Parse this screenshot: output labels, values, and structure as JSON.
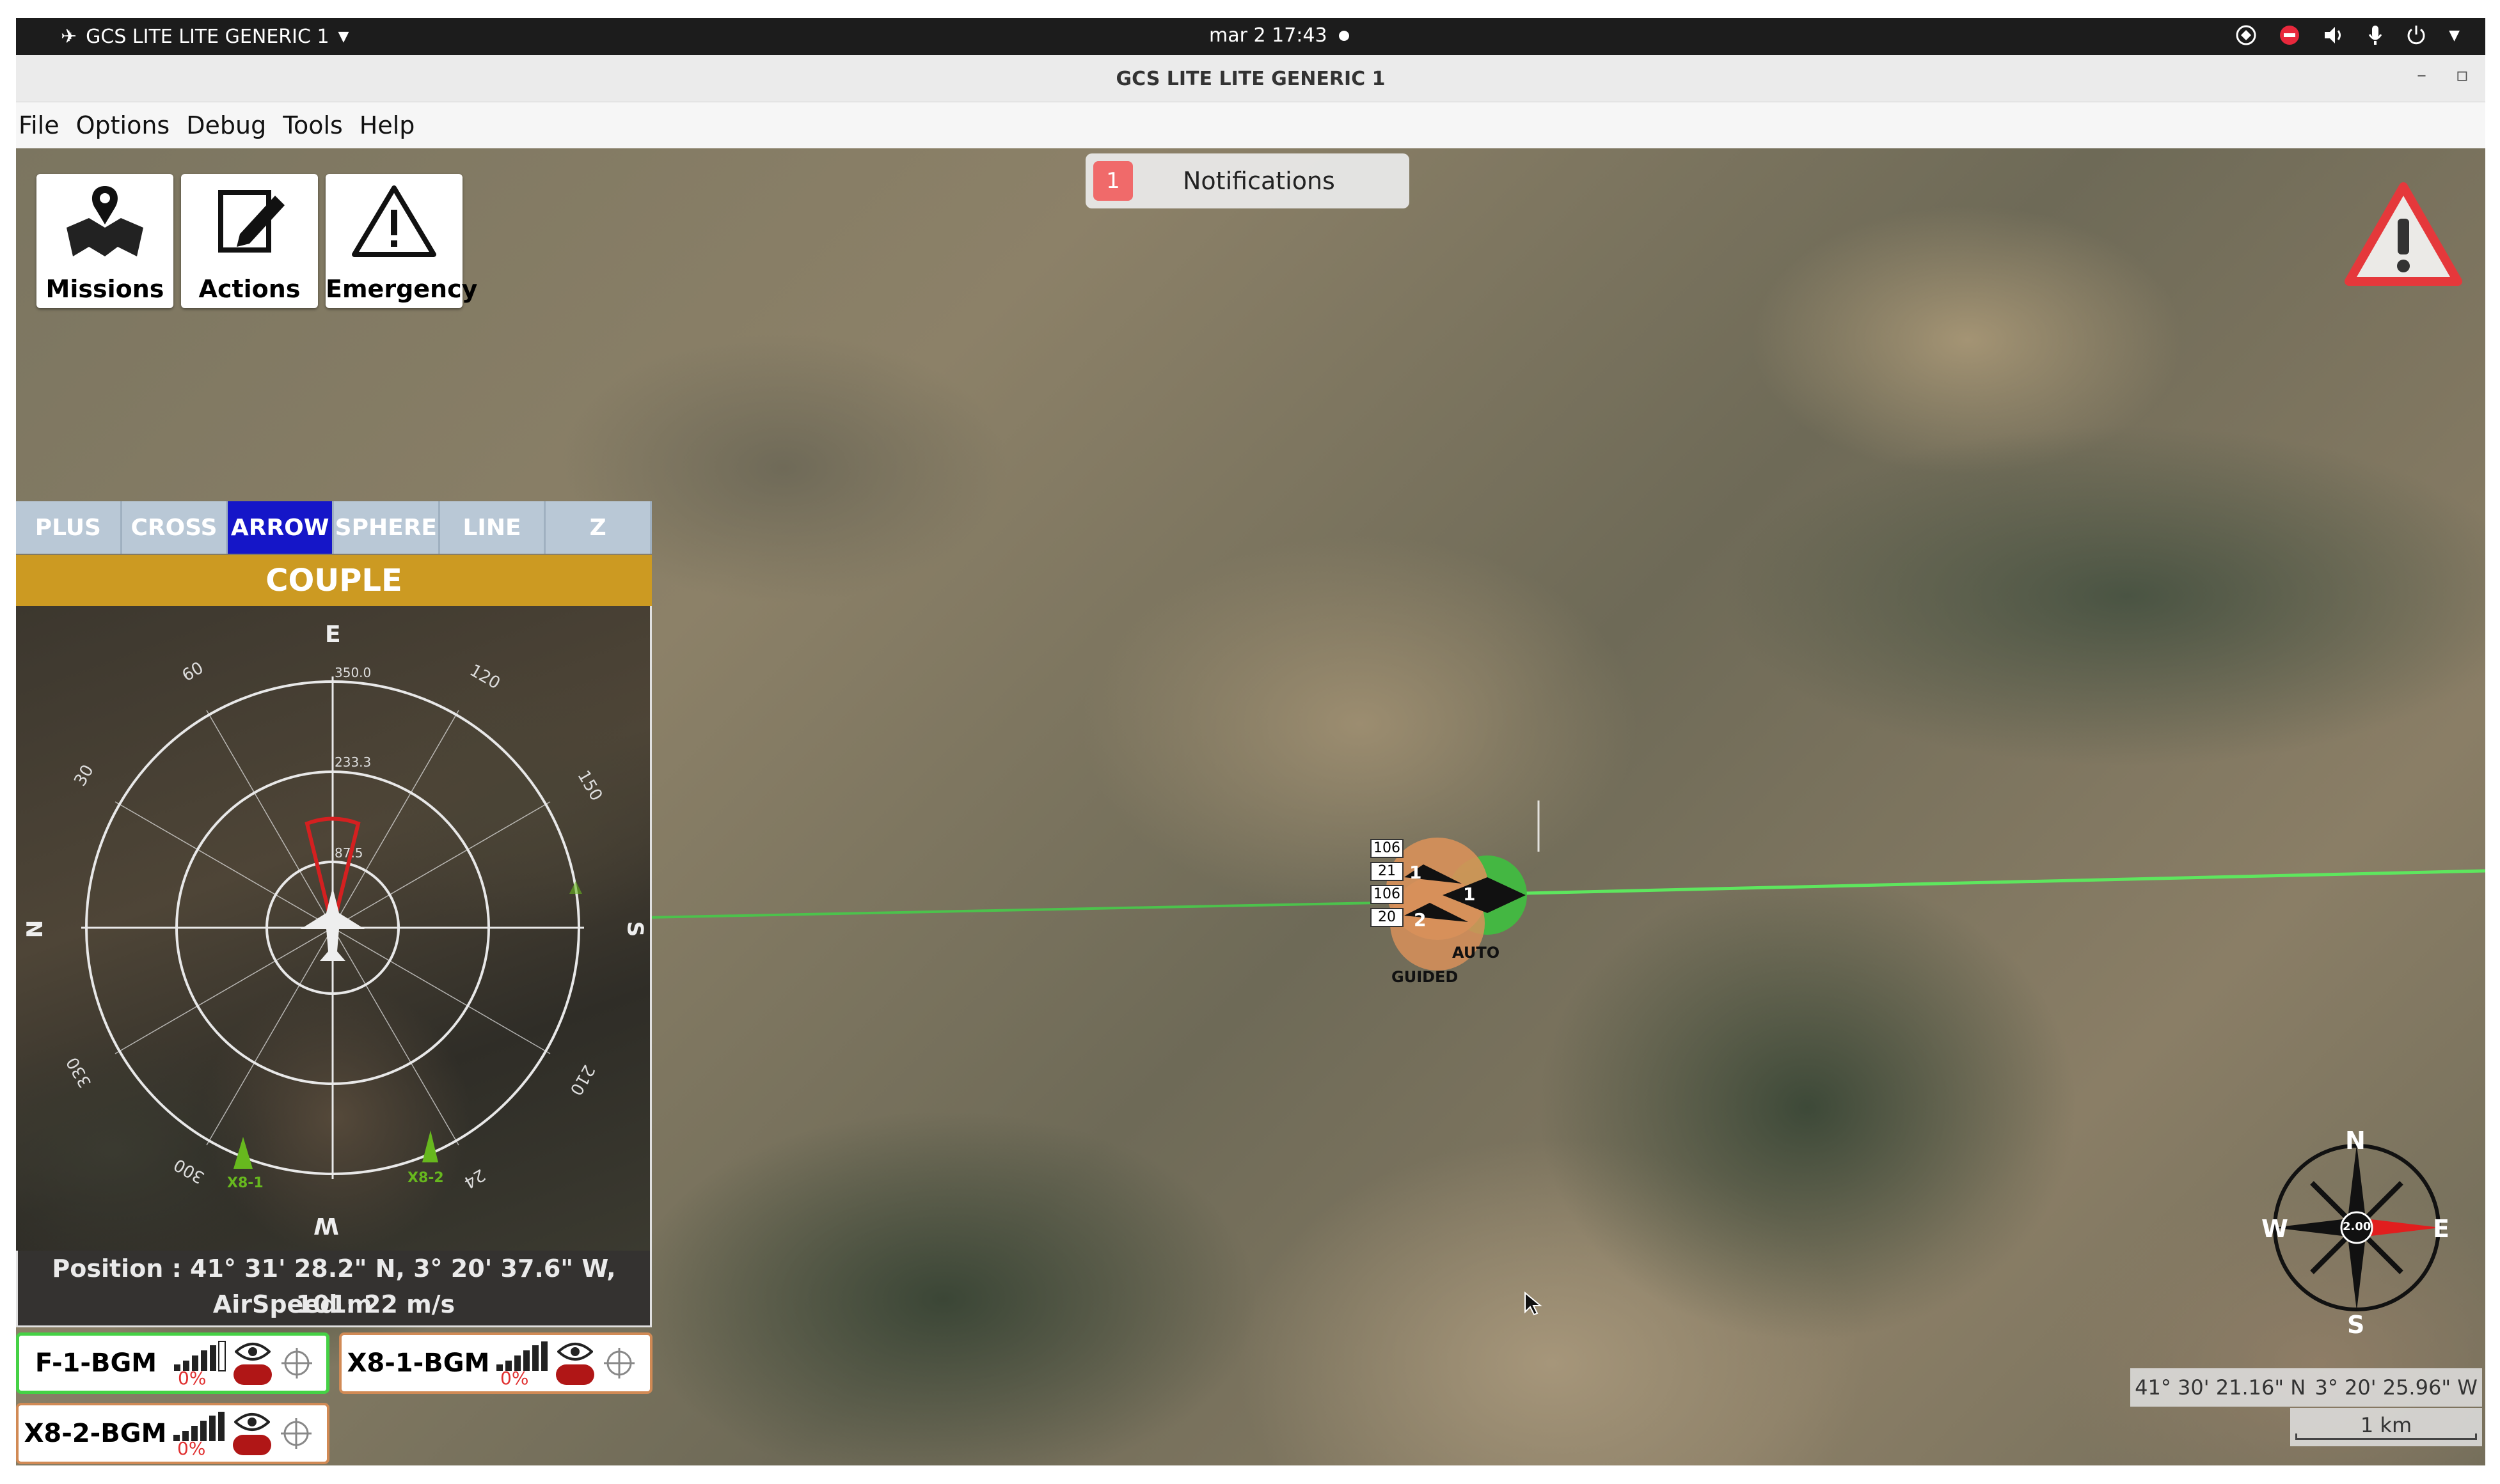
{
  "system_bar": {
    "app_name": "GCS LITE LITE GENERIC 1",
    "datetime": "mar 2  17:43"
  },
  "window": {
    "title": "GCS LITE LITE GENERIC 1",
    "minimize": "–",
    "restore": "▫"
  },
  "menu": {
    "items": [
      "File",
      "Options",
      "Debug",
      "Tools",
      "Help"
    ]
  },
  "toolbar": {
    "missions_label": "Missions",
    "actions_label": "Actions",
    "emergency_label": "Emergency"
  },
  "notifications": {
    "count": "1",
    "label": "Notifications"
  },
  "mode_tabs": [
    {
      "label": "PLUS",
      "active": false
    },
    {
      "label": "CROSS",
      "active": false
    },
    {
      "label": "ARROW",
      "active": true
    },
    {
      "label": "SPHERE",
      "active": false
    },
    {
      "label": "LINE",
      "active": false
    },
    {
      "label": "Z",
      "active": false
    }
  ],
  "couple_label": "COUPLE",
  "radar": {
    "cardinals": {
      "top": "E",
      "right": "S",
      "bottom": "W",
      "left": "N"
    },
    "bearings": [
      "60",
      "120",
      "30",
      "150",
      "330",
      "210",
      "300",
      "24"
    ],
    "ranges": [
      "350.0",
      "233.3",
      "87.5"
    ],
    "targets": [
      "X8-1",
      "X8-2"
    ]
  },
  "position": {
    "position_text": "Position :  41° 31' 28.2\" N, 3° 20' 37.6\" W, 101m",
    "airspeed_text": "AirSpeed : 22 m/s"
  },
  "vehicles": [
    {
      "name": "F-1-BGM",
      "battery": "0%"
    },
    {
      "name": "X8-1-BGM",
      "battery": "0%"
    },
    {
      "name": "X8-2-BGM",
      "battery": "0%"
    }
  ],
  "map_overlay": {
    "vehicle_labels": [
      "106",
      "21",
      "106",
      "20"
    ],
    "vehicle_ids": [
      "1",
      "2",
      "1"
    ],
    "mode_auto": "AUTO",
    "mode_guided": "GUIDED",
    "compass_value": "2.00",
    "compass_letters": {
      "n": "N",
      "s": "S",
      "e": "E",
      "w": "W"
    },
    "lat": "41° 30' 21.16\" N",
    "lon": "3° 20' 25.96\" W",
    "scale": "1 km"
  }
}
